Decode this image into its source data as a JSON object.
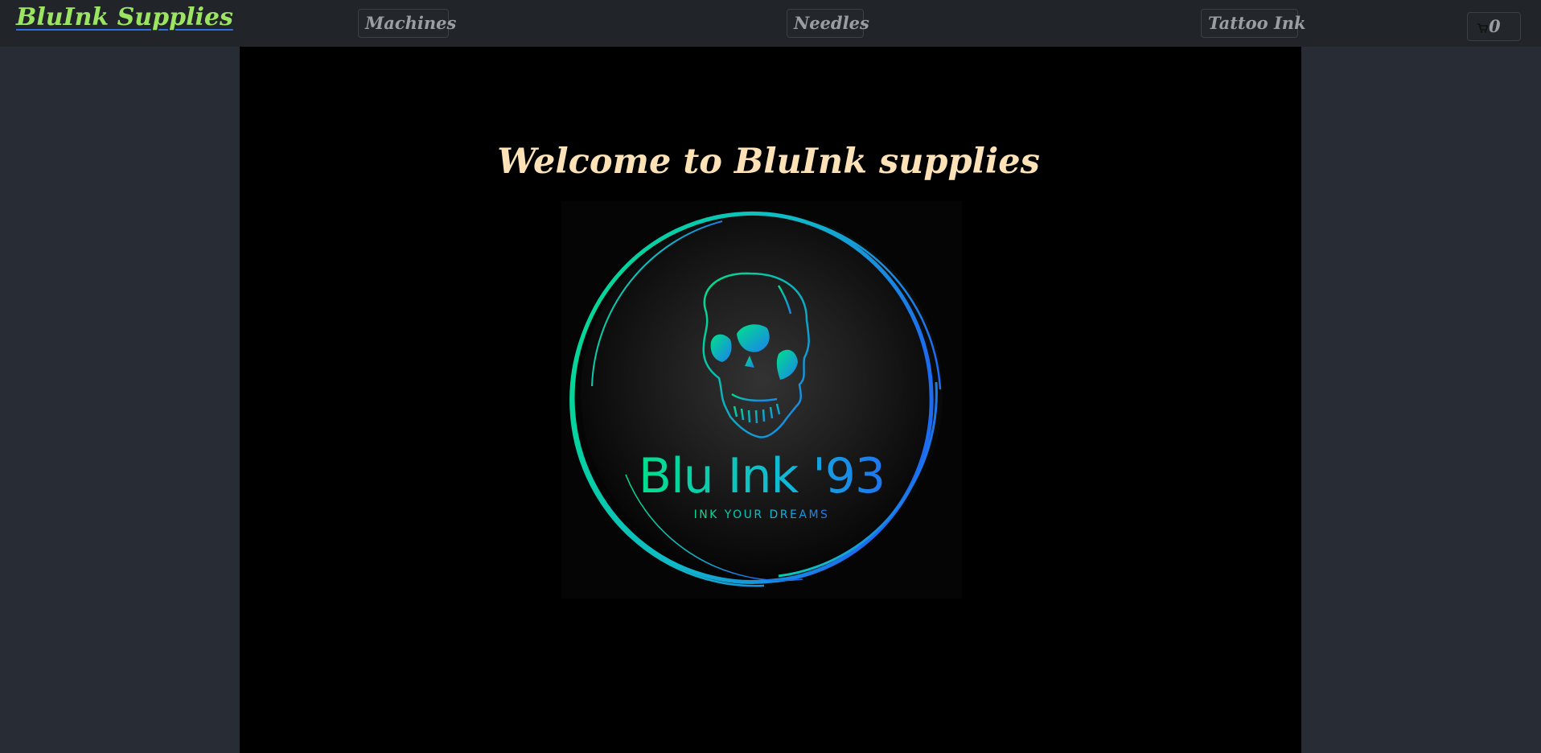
{
  "header": {
    "brand": "BluInk Supplies",
    "nav": [
      "Machines",
      "Needles",
      "Tattoo Ink"
    ],
    "cart_icon": "cart-icon",
    "cart_count": "0"
  },
  "hero": {
    "title": "Welcome to BluInk supplies",
    "logo_title": "Blu Ink '93",
    "logo_tagline": "INK YOUR DREAMS"
  },
  "colors": {
    "brand": "#9be563",
    "title": "#fde2b8",
    "logo_gradient_start": "#00e08a",
    "logo_gradient_end": "#1d6cf0",
    "navbar_bg": "#212429",
    "page_bg": "#282c34",
    "content_bg": "#000000"
  }
}
